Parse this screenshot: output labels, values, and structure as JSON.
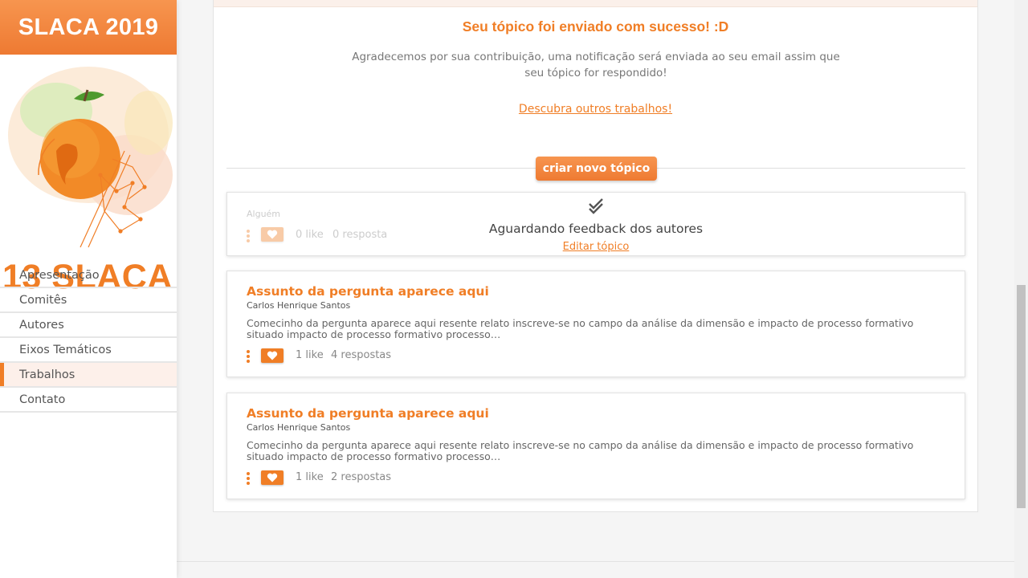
{
  "sidebar": {
    "brand": "SLACA 2019",
    "logo_text": "13 SLACA",
    "menu": [
      {
        "label": "Apresentação"
      },
      {
        "label": "Comitês"
      },
      {
        "label": "Autores"
      },
      {
        "label": "Eixos Temáticos"
      },
      {
        "label": "Trabalhos",
        "active": true
      },
      {
        "label": "Contato"
      }
    ]
  },
  "success": {
    "title": "Seu tópico foi enviado com sucesso! :D",
    "text": "Agradecemos por sua contribuição, uma notificação será enviada ao seu email assim que seu tópico for respondido!",
    "link": "Descubra outros trabalhos!"
  },
  "new_topic_button": "criar novo tópico",
  "pending_topic": {
    "author": "Alguém",
    "likes": "0 like",
    "responses": "0 resposta",
    "status": "Aguardando feedback dos autores",
    "edit_link": "Editar tópico"
  },
  "topics": [
    {
      "title": "Assunto da pergunta aparece aqui",
      "author": "Carlos Henrique Santos",
      "excerpt": "Comecinho da pergunta aparece aqui resente relato inscreve-se no campo da análise da dimensão e impacto de processo formativo situado impacto de processo formativo processo…",
      "likes": "1 like",
      "responses": "4 respostas"
    },
    {
      "title": "Assunto da pergunta aparece aqui",
      "author": "Carlos Henrique Santos",
      "excerpt": "Comecinho da pergunta aparece aqui resente relato inscreve-se no campo da análise da dimensão e impacto de processo formativo situado impacto de processo formativo processo…",
      "likes": "1 like",
      "responses": "2 respostas"
    }
  ],
  "icons": {
    "like": "heart-icon",
    "menu": "vertical-dots-icon",
    "status": "double-check-icon"
  },
  "colors": {
    "accent": "#f07e26",
    "active_bg": "#fdf0ea"
  }
}
